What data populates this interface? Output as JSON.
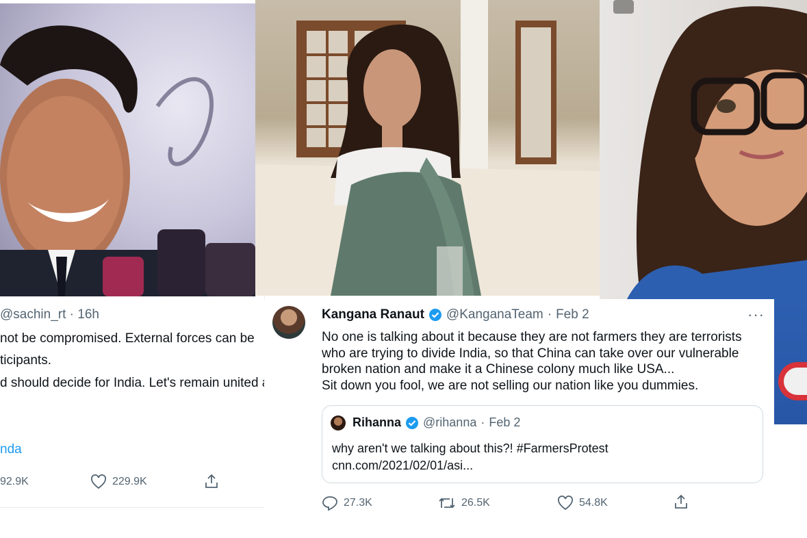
{
  "left_tweet": {
    "handle": "@sachin_rt",
    "separator": "·",
    "time": "16h",
    "lines": [
      "not be compromised. External forces can be",
      "ticipants.",
      "d should decide for India. Let's remain united as a"
    ],
    "hashtag_fragment": "nda",
    "retweets": "92.9K",
    "likes": "229.9K"
  },
  "main_tweet": {
    "name": "Kangana Ranaut",
    "handle": "@KanganaTeam",
    "separator": "·",
    "date": "Feb 2",
    "more": "···",
    "lines": [
      "No one is talking about it because they are not farmers they are terrorists",
      "who are trying to divide India, so that China can take over our vulnerable",
      "broken nation and make it a Chinese colony much like USA...",
      "Sit down you fool, we are not selling our nation like you dummies."
    ],
    "quoted": {
      "name": "Rihanna",
      "handle": "@rihanna",
      "separator": "·",
      "date": "Feb 2",
      "text": "why aren't we talking about this?! #FarmersProtest",
      "link": "cnn.com/2021/02/01/asi..."
    },
    "replies": "27.3K",
    "retweets": "26.5K",
    "likes": "54.8K"
  },
  "colors": {
    "verified": "#1d9bf0",
    "secondary_text": "#536471",
    "link": "#1d9bf0"
  },
  "icons": [
    "reply-icon",
    "retweet-icon",
    "heart-icon",
    "share-icon",
    "verified-badge-icon",
    "more-icon"
  ]
}
